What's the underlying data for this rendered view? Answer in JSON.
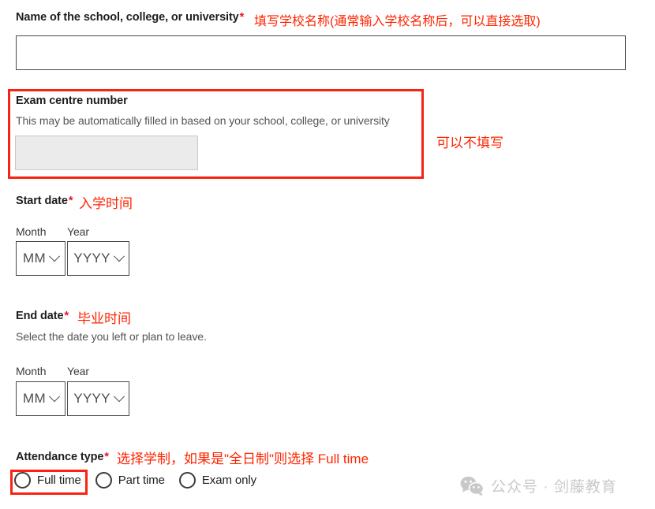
{
  "form": {
    "school_name": {
      "label": "Name of the school, college, or university",
      "required_marker": "*",
      "value": "",
      "placeholder": "",
      "annotation": "填写学校名称(通常输入学校名称后，可以直接选取)"
    },
    "exam_centre": {
      "label": "Exam centre number",
      "hint": "This may be automatically filled in based on your school, college, or university",
      "value": "",
      "placeholder": "",
      "annotation": "可以不填写"
    },
    "start_date": {
      "label": "Start date",
      "required_marker": "*",
      "annotation": "入学时间",
      "month_label": "Month",
      "year_label": "Year",
      "month_value": "MM",
      "year_value": "YYYY",
      "caret_icon": "chevron-down-icon"
    },
    "end_date": {
      "label": "End date",
      "required_marker": "*",
      "annotation": "毕业时间",
      "hint": "Select the date you left or plan to leave.",
      "month_label": "Month",
      "year_label": "Year",
      "month_value": "MM",
      "year_value": "YYYY",
      "caret_icon": "chevron-down-icon"
    },
    "attendance_type": {
      "label": "Attendance type",
      "required_marker": "*",
      "annotation": "选择学制，如果是\"全日制\"则选择 Full time",
      "options": [
        {
          "label": "Full time",
          "selected": false
        },
        {
          "label": "Part time",
          "selected": false
        },
        {
          "label": "Exam only",
          "selected": false
        }
      ]
    }
  },
  "watermark": {
    "icon": "wechat-icon",
    "text": "公众号 · 剑藤教育"
  },
  "colors": {
    "annotation_red": "#ff2400",
    "highlight_box_red": "#fa2213",
    "required_red": "#e8112d",
    "input_border": "#4a4a4a",
    "disabled_bg": "#ebebeb",
    "watermark_grey": "#c9c9c9"
  }
}
